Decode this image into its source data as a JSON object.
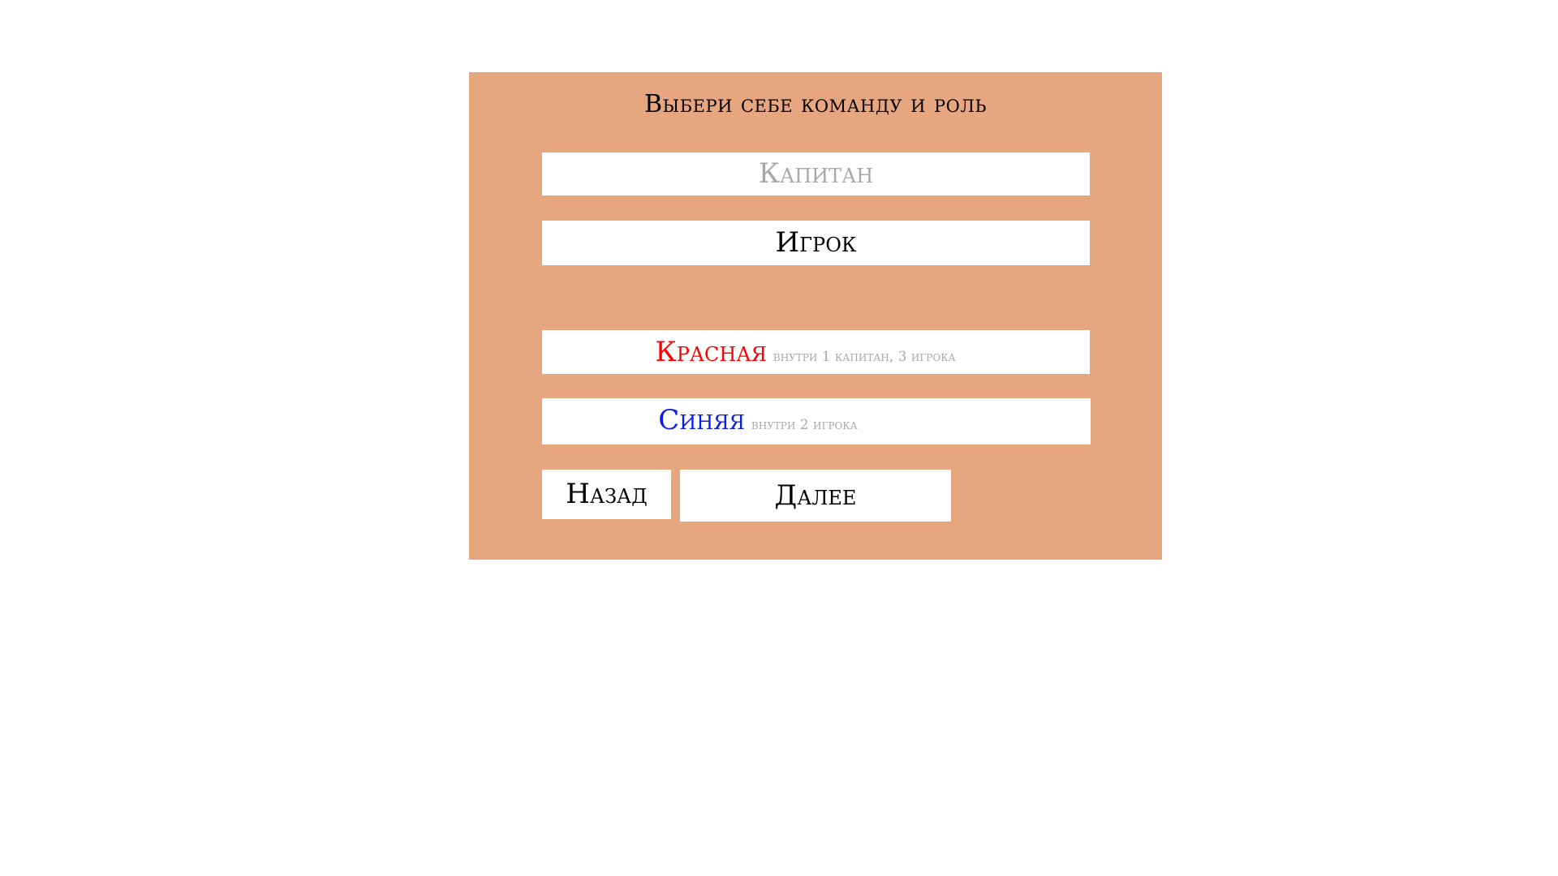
{
  "dialog": {
    "title": "Выбери себе команду и роль"
  },
  "roles": {
    "captain_label": "Капитан",
    "player_label": "Игрок"
  },
  "teams": {
    "red": {
      "name": "Красная",
      "hint": "внутри 1 капитан, 3 игрока",
      "color": "#ff0000"
    },
    "blue": {
      "name": "Синяя",
      "hint": "внутри 2 игрока",
      "color": "#0a1ce8"
    }
  },
  "actions": {
    "back_label": "Назад",
    "next_label": "Далее"
  },
  "colors": {
    "panel_background": "#e6a680",
    "disabled_text": "#a8a8a8"
  }
}
